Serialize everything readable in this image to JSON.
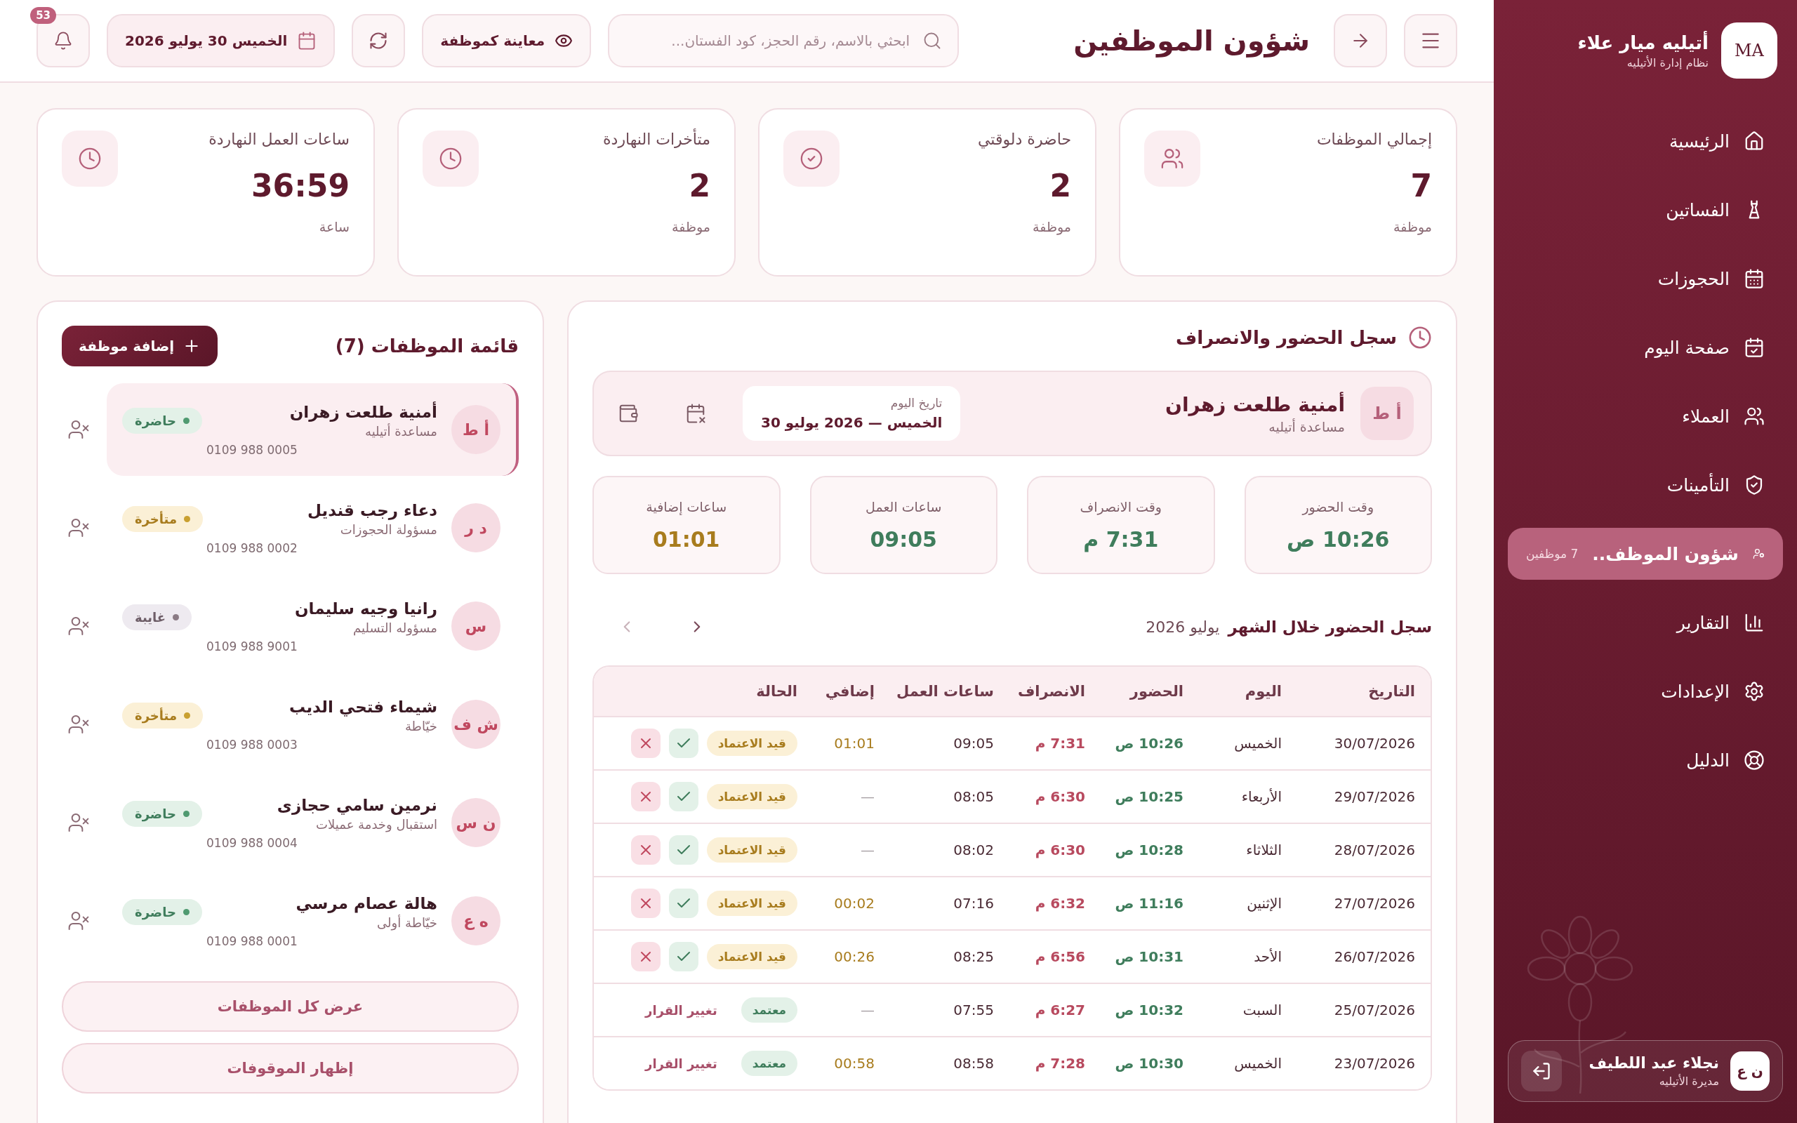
{
  "sidebar": {
    "brand": {
      "logo": "MA",
      "name": "أتيليه ميار علاء",
      "subtitle": "نظام إدارة الأتيليه"
    },
    "items": [
      {
        "label": "الرئيسية",
        "selected": false
      },
      {
        "label": "الفساتين",
        "selected": false
      },
      {
        "label": "الحجوزات",
        "selected": false
      },
      {
        "label": "صفحة اليوم",
        "selected": false
      },
      {
        "label": "العملاء",
        "selected": false
      },
      {
        "label": "التأمينات",
        "selected": false
      },
      {
        "label": "شؤون الموظف..",
        "selected": true,
        "badge": "7 موظفين"
      },
      {
        "label": "التقارير",
        "selected": false
      },
      {
        "label": "الإعدادات",
        "selected": false
      },
      {
        "label": "الدليل",
        "selected": false
      }
    ],
    "user": {
      "initials": "ن ع",
      "name": "نجلاء عبد اللطيف",
      "role": "مديرة الأتيليه"
    }
  },
  "header": {
    "title": "شؤون الموظفين",
    "search": {
      "placeholder": "ابحثي بالاسم، رقم الحجز، كود الفستان..."
    },
    "preview_button": "معاينة كموظفة",
    "date": "الخميس 30 يوليو 2026",
    "notifications": "53"
  },
  "stats": [
    {
      "label": "إجمالي الموظفات",
      "value": "7",
      "unit": "موظفة"
    },
    {
      "label": "حاضرة دلوقتي",
      "value": "2",
      "unit": "موظفة"
    },
    {
      "label": "متأخرات النهاردة",
      "value": "2",
      "unit": "موظفة"
    },
    {
      "label": "ساعات العمل النهاردة",
      "value": "36:59",
      "unit": "ساعة"
    }
  ],
  "attendance": {
    "title": "سجل الحضور والانصراف",
    "employee": {
      "initials": "أ ط",
      "name": "أمنية طلعت زهران",
      "role": "مساعدة أتيليه"
    },
    "today": {
      "label": "تاريخ اليوم",
      "value": "الخميس — 2026 يوليو 30"
    },
    "metrics": [
      {
        "label": "وقت الحضور",
        "value": "10:26 ص",
        "kind": "time"
      },
      {
        "label": "وقت الانصراف",
        "value": "7:31 م",
        "kind": "time"
      },
      {
        "label": "ساعات العمل",
        "value": "09:05",
        "kind": "time"
      },
      {
        "label": "ساعات إضافية",
        "value": "01:01",
        "kind": "extra"
      }
    ],
    "month": {
      "title": "سجل الحضور خلال الشهر",
      "value": "يوليو 2026"
    },
    "table": {
      "columns": [
        "التاريخ",
        "اليوم",
        "الحضور",
        "الانصراف",
        "ساعات العمل",
        "إضافي",
        "الحالة"
      ],
      "rows": [
        {
          "date": "30/07/2026",
          "day": "الخميس",
          "check_in": "10:26 ص",
          "check_out": "7:31 م",
          "hours": "09:05",
          "extra": "01:01",
          "status": "قيد الاعتماد",
          "kind": "pending"
        },
        {
          "date": "29/07/2026",
          "day": "الأربعاء",
          "check_in": "10:25 ص",
          "check_out": "6:30 م",
          "hours": "08:05",
          "extra": "—",
          "status": "قيد الاعتماد",
          "kind": "pending"
        },
        {
          "date": "28/07/2026",
          "day": "الثلاثاء",
          "check_in": "10:28 ص",
          "check_out": "6:30 م",
          "hours": "08:02",
          "extra": "—",
          "status": "قيد الاعتماد",
          "kind": "pending"
        },
        {
          "date": "27/07/2026",
          "day": "الإثنين",
          "check_in": "11:16 ص",
          "check_out": "6:32 م",
          "hours": "07:16",
          "extra": "00:02",
          "status": "قيد الاعتماد",
          "kind": "pending"
        },
        {
          "date": "26/07/2026",
          "day": "الأحد",
          "check_in": "10:31 ص",
          "check_out": "6:56 م",
          "hours": "08:25",
          "extra": "00:26",
          "status": "قيد الاعتماد",
          "kind": "pending"
        },
        {
          "date": "25/07/2026",
          "day": "السبت",
          "check_in": "10:32 ص",
          "check_out": "6:27 م",
          "hours": "07:55",
          "extra": "—",
          "status": "معتمد",
          "kind": "approved",
          "action": "تغيير القرار"
        },
        {
          "date": "23/07/2026",
          "day": "الخميس",
          "check_in": "10:30 ص",
          "check_out": "7:28 م",
          "hours": "08:58",
          "extra": "00:58",
          "status": "معتمد",
          "kind": "approved",
          "action": "تغيير القرار"
        }
      ]
    }
  },
  "employees": {
    "title": "قائمة الموظفات (7)",
    "add_button": "إضافة موظفة",
    "items": [
      {
        "initials": "أ ط",
        "name": "أمنية طلعت زهران",
        "role": "مساعدة أتيليه",
        "phone": "0109 988 0005",
        "status": "حاضرة",
        "kind": "present",
        "selected": true
      },
      {
        "initials": "د ر",
        "name": "دعاء رجب قنديل",
        "role": "مسؤولة الحجوزات",
        "phone": "0109 988 0002",
        "status": "متأخرة",
        "kind": "late",
        "selected": false
      },
      {
        "initials": "س",
        "name": "رانيا وجيه سليمان",
        "role": "مسؤوله التسليم",
        "phone": "0109 988 9001",
        "status": "غايبة",
        "kind": "absent",
        "selected": false
      },
      {
        "initials": "ش ف",
        "name": "شيماء فتحي الديب",
        "role": "خيّاطة",
        "phone": "0109 988 0003",
        "status": "متأخرة",
        "kind": "late",
        "selected": false
      },
      {
        "initials": "ن س",
        "name": "نرمين سامي حجازى",
        "role": "استقبال وخدمة عميلات",
        "phone": "0109 988 0004",
        "status": "حاضرة",
        "kind": "present",
        "selected": false
      },
      {
        "initials": "ه ع",
        "name": "هالة عصام مرسي",
        "role": "خيّاطة أولى",
        "phone": "0109 988 0001",
        "status": "حاضرة",
        "kind": "present",
        "selected": false
      }
    ],
    "buttons": [
      "عرض كل الموظفات",
      "إظهار الموقوفات"
    ]
  }
}
